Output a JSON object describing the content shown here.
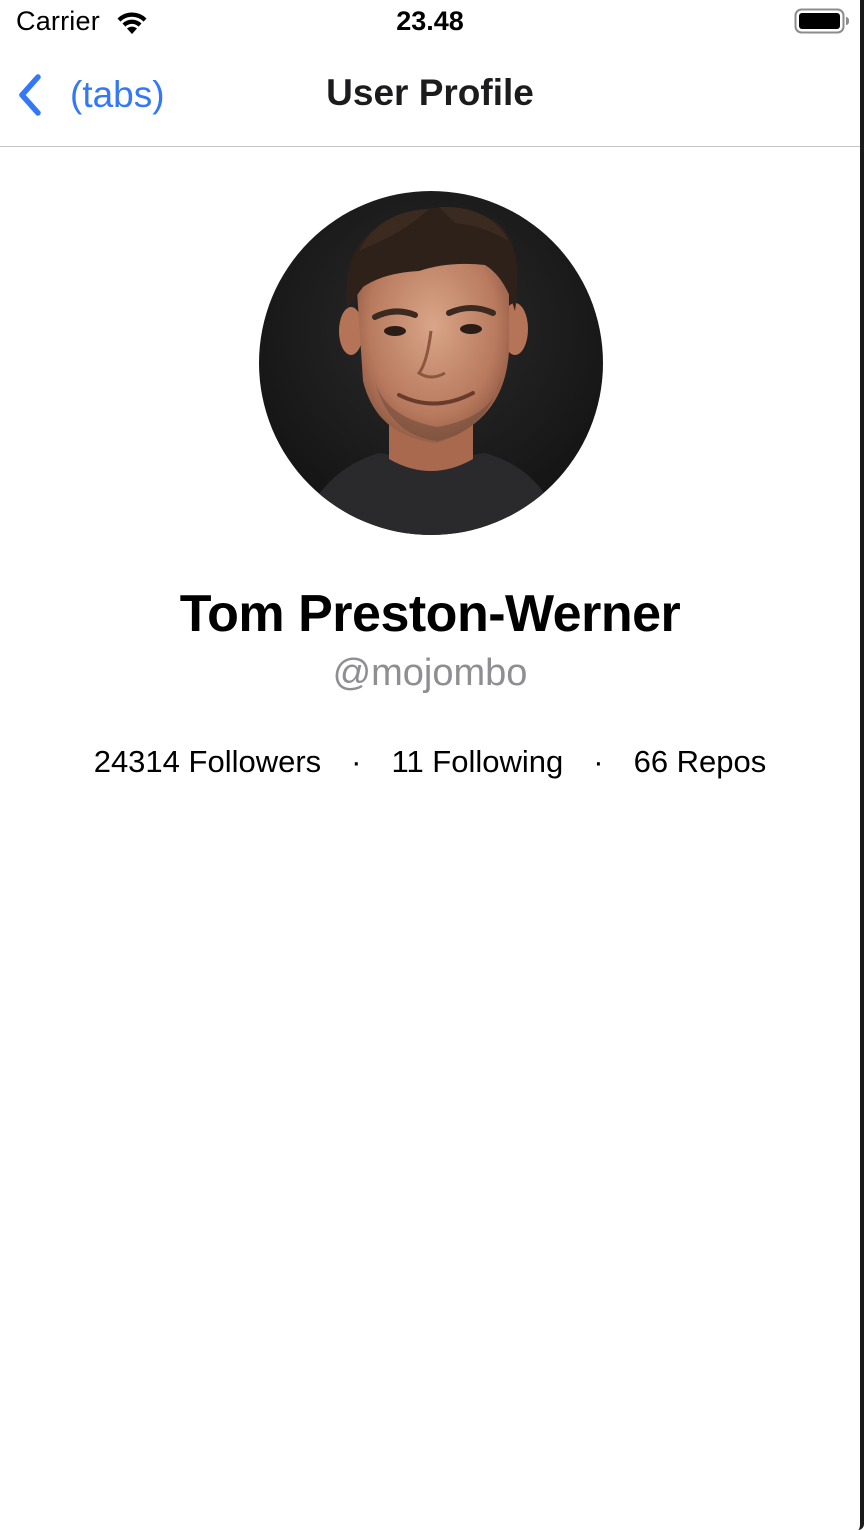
{
  "status_bar": {
    "carrier": "Carrier",
    "time": "23.48",
    "wifi_icon": "wifi-icon",
    "battery_icon": "battery-icon"
  },
  "nav": {
    "back_label": "(tabs)",
    "back_icon": "chevron-left-icon",
    "title": "User Profile",
    "accent_color": "#3478f6"
  },
  "profile": {
    "name": "Tom Preston-Werner",
    "handle": "@mojombo",
    "avatar": "avatar-photo",
    "stats": {
      "followers": "24314 Followers",
      "following": "11 Following",
      "repos": "66 Repos",
      "separator": "·"
    }
  }
}
